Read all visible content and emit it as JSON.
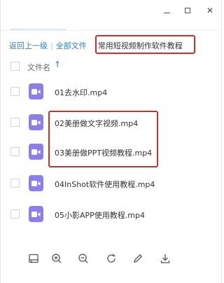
{
  "window": {
    "minimize_icon": "minimize-icon",
    "maximize_icon": "maximize-icon",
    "close_icon": "close-icon",
    "close_glyph": "✕"
  },
  "breadcrumb": {
    "back_label": "返回上一级",
    "separator": "|",
    "all_files_label": "全部文件",
    "current_folder": "常用短视频制作软件教程"
  },
  "list_header": {
    "name_label": "文件名",
    "sort_icon": "sort-ascending-icon",
    "sort_glyph": "↑"
  },
  "files": [
    {
      "name": "01去水印.mp4",
      "icon": "video-file-icon"
    },
    {
      "name": "02美册做文字视频.mp4",
      "icon": "video-file-icon"
    },
    {
      "name": "03美册做PPT视频教程.mp4",
      "icon": "video-file-icon"
    },
    {
      "name": "04InShot软件使用教程.mp4",
      "icon": "video-file-icon"
    },
    {
      "name": "05小影APP使用教程.mp4",
      "icon": "video-file-icon"
    }
  ],
  "toolbar": {
    "items": [
      "screen-icon",
      "zoom-in-icon",
      "zoom-out-icon",
      "rotate-icon",
      "edit-icon",
      "download-icon"
    ]
  },
  "colors": {
    "accent": "#2b7fd6",
    "highlight_box": "#c9302c",
    "video_icon": "#8b7ff0"
  }
}
